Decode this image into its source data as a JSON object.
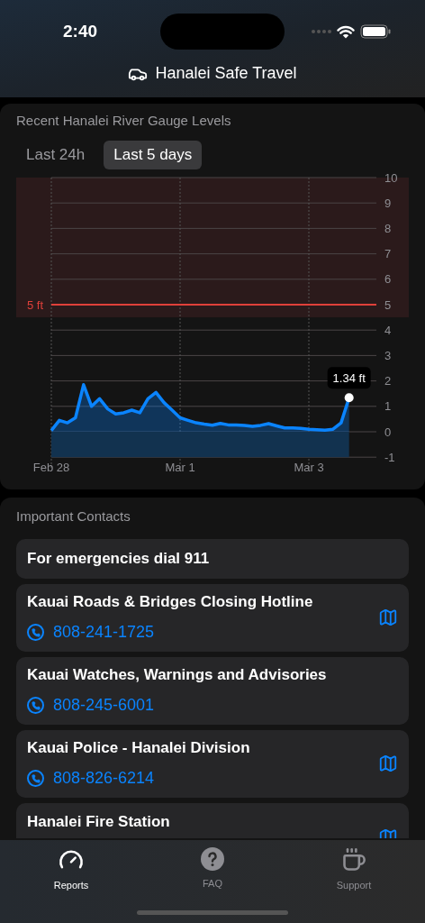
{
  "status_bar": {
    "time": "2:40"
  },
  "header": {
    "title": "Hanalei Safe Travel"
  },
  "gauge": {
    "title": "Recent Hanalei River Gauge Levels",
    "tabs": [
      {
        "label": "Last 24h",
        "selected": false
      },
      {
        "label": "Last 5 days",
        "selected": true
      }
    ],
    "chart_data": {
      "type": "area",
      "categories": [
        "Feb 28",
        null,
        null,
        null,
        null,
        null,
        null,
        null,
        null,
        null,
        null,
        null,
        null,
        null,
        null,
        null,
        "Mar 1",
        null,
        null,
        null,
        null,
        null,
        null,
        null,
        null,
        null,
        null,
        null,
        null,
        null,
        null,
        null,
        "Mar 3",
        null,
        null,
        null,
        null,
        null
      ],
      "ylim": [
        -1,
        10
      ],
      "yticks": [
        -1,
        0,
        1,
        2,
        3,
        4,
        5,
        6,
        7,
        8,
        9,
        10
      ],
      "series": [
        {
          "color": "#0a84ff",
          "values": [
            0.05,
            0.45,
            0.35,
            0.55,
            1.85,
            1.0,
            1.3,
            0.9,
            0.7,
            0.75,
            0.85,
            0.75,
            1.3,
            1.55,
            1.15,
            0.85,
            0.55,
            0.45,
            0.35,
            0.3,
            0.26,
            0.33,
            0.27,
            0.27,
            0.25,
            0.21,
            0.25,
            0.32,
            0.23,
            0.15,
            0.15,
            0.13,
            0.1,
            0.08,
            0.06,
            0.1,
            0.35,
            1.34
          ]
        }
      ],
      "grid": true,
      "bands": [
        {
          "axis": "y",
          "from": 4.5,
          "to": 10,
          "color": "#2b1a1b"
        }
      ],
      "ref_lines": [
        {
          "axis": "y",
          "value": 5,
          "label": "5 ft",
          "color": "#e0403a"
        }
      ],
      "annotations": [
        {
          "text": "1.34 ft",
          "y": 1.34
        }
      ]
    }
  },
  "contacts": {
    "title": "Important Contacts",
    "items": [
      {
        "name": "For emergencies dial 911",
        "map": false
      },
      {
        "name": "Kauai Roads & Bridges Closing Hotline",
        "phone": "808-241-1725",
        "map": true
      },
      {
        "name": "Kauai Watches, Warnings and Advisories",
        "phone": "808-245-6001",
        "map": false
      },
      {
        "name": "Kauai Police - Hanalei Division",
        "phone": "808-826-6214",
        "map": true
      },
      {
        "name": "Hanalei Fire Station",
        "map": true
      }
    ]
  },
  "tab_bar": [
    {
      "label": "Reports",
      "selected": true
    },
    {
      "label": "FAQ",
      "selected": false
    },
    {
      "label": "Support",
      "selected": false
    }
  ]
}
